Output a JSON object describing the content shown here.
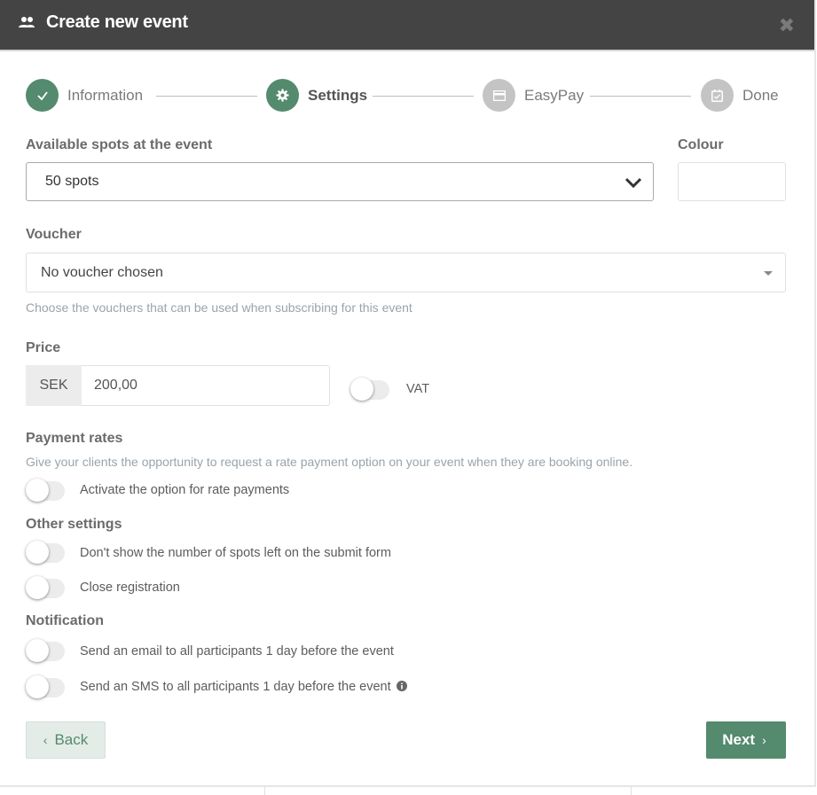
{
  "header": {
    "title": "Create new event",
    "icon": "group-icon",
    "close_icon": "close-icon"
  },
  "stepper": {
    "steps": [
      {
        "label": "Information",
        "state": "done",
        "icon": "check-icon"
      },
      {
        "label": "Settings",
        "state": "active",
        "icon": "gear-icon"
      },
      {
        "label": "EasyPay",
        "state": "todo",
        "icon": "card-icon"
      },
      {
        "label": "Done",
        "state": "todo",
        "icon": "calendar-check-icon"
      }
    ]
  },
  "spots": {
    "label": "Available spots at the event",
    "value": "50 spots"
  },
  "colour": {
    "label": "Colour",
    "value": ""
  },
  "voucher": {
    "label": "Voucher",
    "value": "No voucher chosen",
    "help": "Choose the vouchers that can be used when subscribing for this event"
  },
  "price": {
    "label": "Price",
    "currency": "SEK",
    "value": "200,00",
    "vat_label": "VAT",
    "vat_on": false
  },
  "payment_rates": {
    "title": "Payment rates",
    "help": "Give your clients the opportunity to request a rate payment option on your event when they are booking online.",
    "toggle_label": "Activate the option for rate payments",
    "on": false
  },
  "other_settings": {
    "title": "Other settings",
    "items": [
      {
        "label": "Don't show the number of spots left on the submit form",
        "on": false
      },
      {
        "label": "Close registration",
        "on": false
      }
    ]
  },
  "notification": {
    "title": "Notification",
    "items": [
      {
        "label": "Send an email to all participants 1 day before the event",
        "on": false
      },
      {
        "label": "Send an SMS to all participants 1 day before the event",
        "on": false
      }
    ]
  },
  "buttons": {
    "back": "Back",
    "next": "Next"
  },
  "colors": {
    "accent": "#548a6d",
    "header_bg": "#444444",
    "step_inactive": "#c4c4c4",
    "help_text": "#98a4ab"
  }
}
